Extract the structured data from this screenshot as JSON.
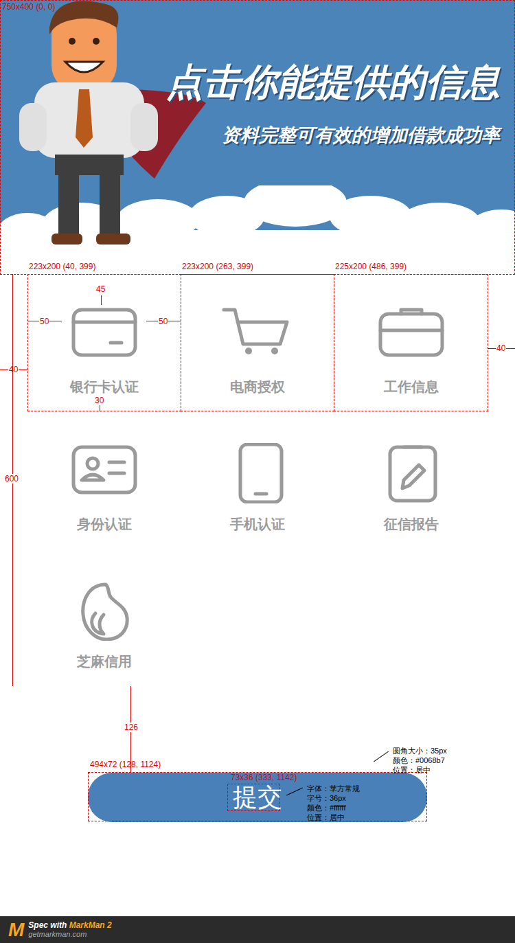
{
  "banner": {
    "title": "点击你能提供的信息",
    "subtitle": "资料完整可有效的增加借款成功率"
  },
  "items": [
    {
      "label": "银行卡认证"
    },
    {
      "label": "电商授权"
    },
    {
      "label": "工作信息"
    },
    {
      "label": "身份认证"
    },
    {
      "label": "手机认证"
    },
    {
      "label": "征信报告"
    },
    {
      "label": "芝麻信用"
    }
  ],
  "submit": {
    "label": "提交"
  },
  "annotations": {
    "banner_box": "750x400 (0, 0)",
    "cells": [
      "223x200 (40, 399)",
      "223x200 (263, 399)",
      "225x200 (486, 399)"
    ],
    "icon_top": "45",
    "icon_left": "50",
    "icon_right": "50",
    "label_bottom": "30",
    "row_right": "40",
    "grid_left": "40",
    "grid_height": "600",
    "button_gap": "126",
    "button_box": "494x72 (128, 1124)",
    "text_box": "73x36 (333, 1142)",
    "button_notes": [
      "圆角大小：35px",
      "颜色：#0068b7",
      "位置：居中"
    ],
    "text_notes": [
      "字体：苹方常规",
      "字号：36px",
      "颜色：#ffffff",
      "位置：居中"
    ]
  },
  "footer": {
    "logo": "M",
    "brand_prefix": "Spec with ",
    "brand": "MarkMan 2",
    "site": "getmarkman.com"
  }
}
